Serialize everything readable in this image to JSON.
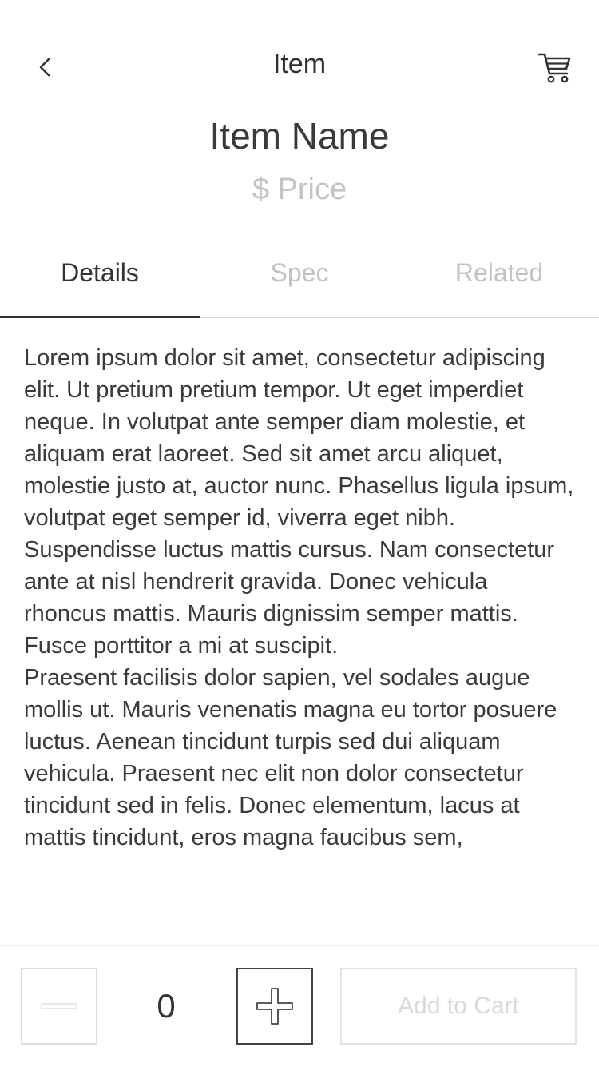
{
  "header": {
    "title": "Item"
  },
  "item": {
    "name": "Item Name",
    "price": "$ Price"
  },
  "tabs": [
    {
      "label": "Details",
      "active": true
    },
    {
      "label": "Spec",
      "active": false
    },
    {
      "label": "Related",
      "active": false
    }
  ],
  "details": {
    "paragraphs": [
      "Lorem ipsum dolor sit amet, consectetur adipiscing elit. Ut pretium pretium tempor. Ut eget imperdiet neque. In volutpat ante semper diam molestie, et aliquam erat laoreet. Sed sit amet arcu aliquet, molestie justo at, auctor nunc. Phasellus ligula ipsum, volutpat eget semper id, viverra eget nibh. Suspendisse luctus mattis cursus. Nam consectetur ante at nisl hendrerit gravida. Donec vehicula rhoncus mattis. Mauris dignissim semper mattis. Fusce porttitor a mi at suscipit.",
      "Praesent facilisis dolor sapien, vel sodales augue mollis ut. Mauris venenatis magna eu tortor posuere luctus. Aenean tincidunt turpis sed dui aliquam vehicula. Praesent nec elit non dolor consectetur tincidunt sed in felis. Donec elementum, lacus at mattis tincidunt, eros magna faucibus sem,"
    ]
  },
  "quantity": {
    "value": "0"
  },
  "cart_button": {
    "label": "Add to Cart"
  },
  "colors": {
    "active_text": "#333333",
    "inactive_text": "#c2c2c2",
    "disabled_border": "#dcdcdc",
    "enabled_border": "#444444"
  },
  "icons": {
    "back": "chevron-left-icon",
    "cart": "cart-icon",
    "minus": "minus-icon",
    "plus": "plus-icon"
  }
}
